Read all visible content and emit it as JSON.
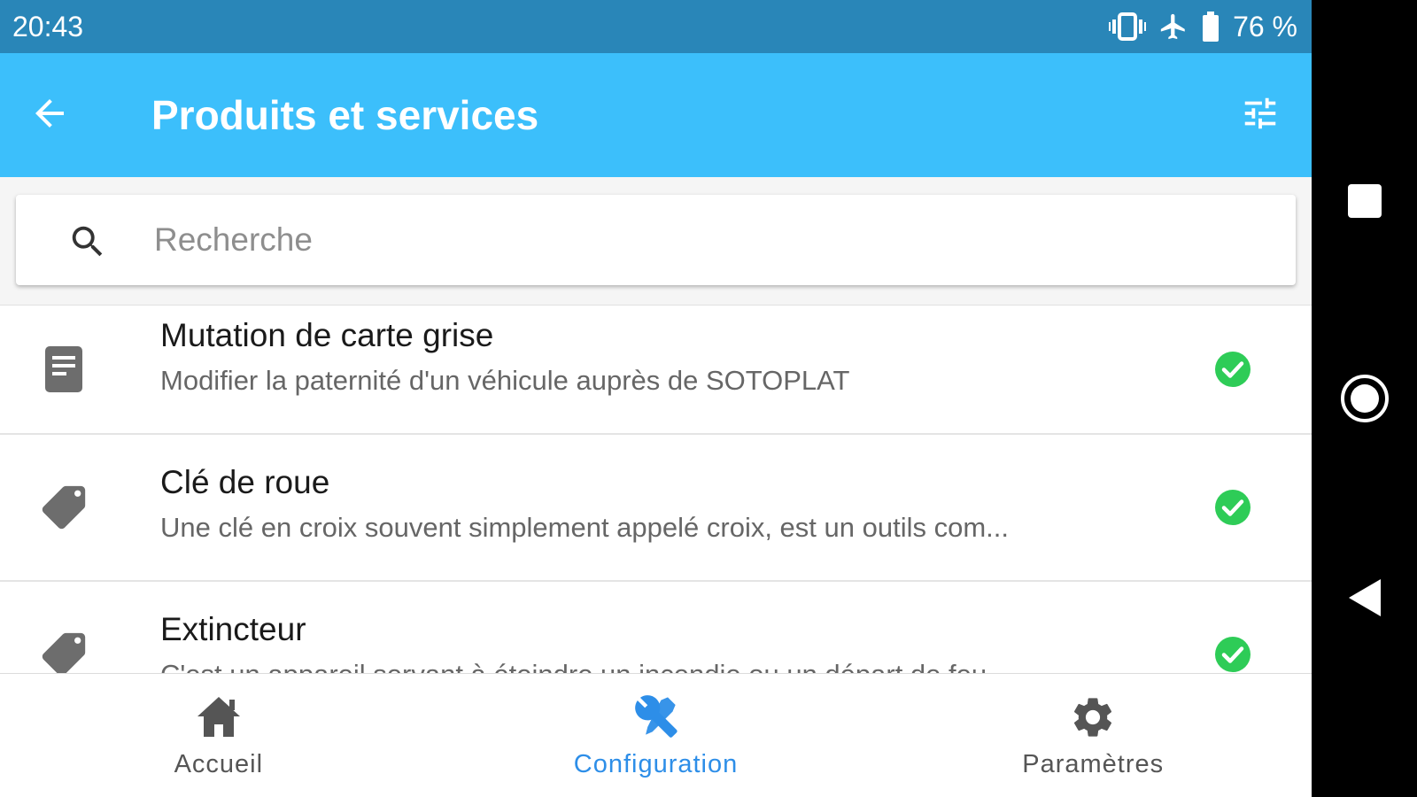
{
  "status_bar": {
    "time": "20:43",
    "battery": "76 %",
    "icons": [
      "vibrate-icon",
      "airplane-mode-icon",
      "battery-icon"
    ]
  },
  "app_bar": {
    "title": "Produits et services",
    "back_icon": "arrow-back-icon",
    "filter_icon": "tune-filter-icon"
  },
  "search": {
    "placeholder": "Recherche",
    "value": ""
  },
  "items": [
    {
      "icon": "document-icon",
      "title": "Mutation de carte grise",
      "description": "Modifier la paternité d'un véhicule auprès de SOTOPLAT",
      "active": true
    },
    {
      "icon": "tag-icon",
      "title": "Clé de roue",
      "description": "Une clé en croix souvent simplement appelé croix, est un outils com...",
      "active": true
    },
    {
      "icon": "tag-icon",
      "title": "Extincteur",
      "description": "C'est un appareil servant à éteindre un incendie ou un départ de feu...",
      "active": true
    }
  ],
  "bottom_nav": {
    "items": [
      {
        "label": "Accueil",
        "icon": "home-icon",
        "active": false
      },
      {
        "label": "Configuration",
        "icon": "tools-icon",
        "active": true
      },
      {
        "label": "Paramètres",
        "icon": "settings-gear-icon",
        "active": false
      }
    ]
  },
  "system_nav": {
    "buttons": [
      "recent-apps-icon",
      "home-circle-icon",
      "back-triangle-icon"
    ]
  },
  "colors": {
    "status_bar": "#2986b8",
    "app_bar": "#3cbffb",
    "active_nav": "#2d8ee8",
    "check_green": "#2ecc57",
    "icon_gray": "#6d6d6d"
  }
}
